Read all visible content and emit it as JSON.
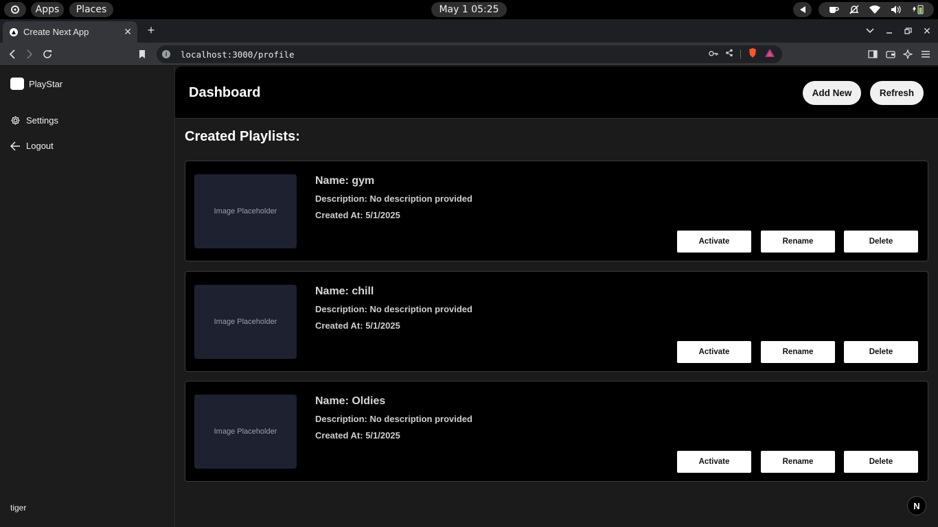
{
  "system": {
    "apps_label": "Apps",
    "places_label": "Places",
    "clock": "May 1  05:25"
  },
  "browser": {
    "tab_title": "Create Next App",
    "url": "localhost:3000/profile"
  },
  "sidebar": {
    "brand": "PlayStar",
    "items": [
      {
        "label": "Settings",
        "icon": "gear-icon"
      },
      {
        "label": "Logout",
        "icon": "arrow-left-icon"
      }
    ],
    "user": "tiger"
  },
  "header": {
    "title": "Dashboard",
    "add_label": "Add New",
    "refresh_label": "Refresh"
  },
  "main": {
    "section_title": "Created Playlists:",
    "playlists": [
      {
        "placeholder": "Image Placeholder",
        "name": "Name: gym",
        "description": "Description: No description provided",
        "created": "Created At: 5/1/2025",
        "activate": "Activate",
        "rename": "Rename",
        "delete": "Delete"
      },
      {
        "placeholder": "Image Placeholder",
        "name": "Name: chill",
        "description": "Description: No description provided",
        "created": "Created At: 5/1/2025",
        "activate": "Activate",
        "rename": "Rename",
        "delete": "Delete"
      },
      {
        "placeholder": "Image Placeholder",
        "name": "Name: Oldies",
        "description": "Description: No description provided",
        "created": "Created At: 5/1/2025",
        "activate": "Activate",
        "rename": "Rename",
        "delete": "Delete"
      }
    ]
  },
  "next_badge": "N"
}
